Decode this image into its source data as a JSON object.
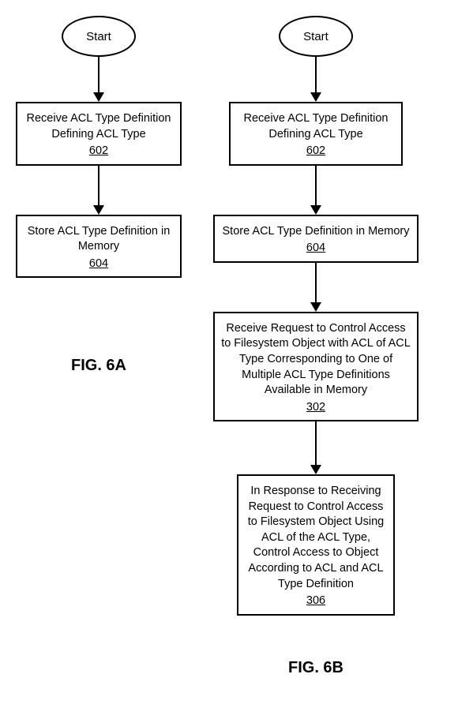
{
  "flowA": {
    "start": "Start",
    "step1_text": "Receive ACL Type Definition Defining ACL Type",
    "step1_ref": "602",
    "step2_text": "Store ACL Type Definition in Memory",
    "step2_ref": "604",
    "label": "FIG. 6A"
  },
  "flowB": {
    "start": "Start",
    "step1_text": "Receive ACL Type Definition Defining ACL Type",
    "step1_ref": "602",
    "step2_text": "Store ACL Type Definition in Memory",
    "step2_ref": "604",
    "step3_text": "Receive Request to Control Access to Filesystem Object with ACL of ACL Type Corresponding to One of Multiple ACL Type Definitions Available in Memory",
    "step3_ref": "302",
    "step4_text": "In Response to Receiving Request to Control Access to Filesystem Object Using ACL of the ACL Type, Control Access to Object According to ACL and ACL Type Definition",
    "step4_ref": "306",
    "label": "FIG. 6B"
  }
}
